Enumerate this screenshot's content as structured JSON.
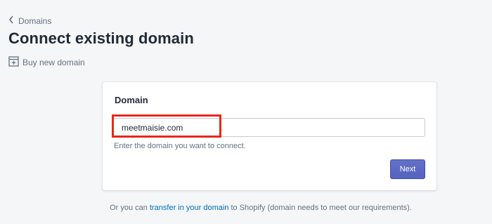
{
  "breadcrumb": {
    "label": "Domains",
    "icon": "chevron-left-icon"
  },
  "page": {
    "title": "Connect existing domain"
  },
  "secondary_action": {
    "label": "Buy new domain",
    "icon": "buy-domain-icon"
  },
  "card": {
    "title": "Domain",
    "input": {
      "value": "meetmaisie.com",
      "placeholder": ""
    },
    "help_text": "Enter the domain you want to connect.",
    "next_label": "Next"
  },
  "footer": {
    "prefix": "Or you can ",
    "link": "transfer in your domain",
    "suffix": " to Shopify (domain needs to meet our requirements)."
  },
  "colors": {
    "accent": "#5c6ac4",
    "highlight": "#e8281b",
    "link": "#006fbb",
    "background": "#f4f6f8"
  }
}
